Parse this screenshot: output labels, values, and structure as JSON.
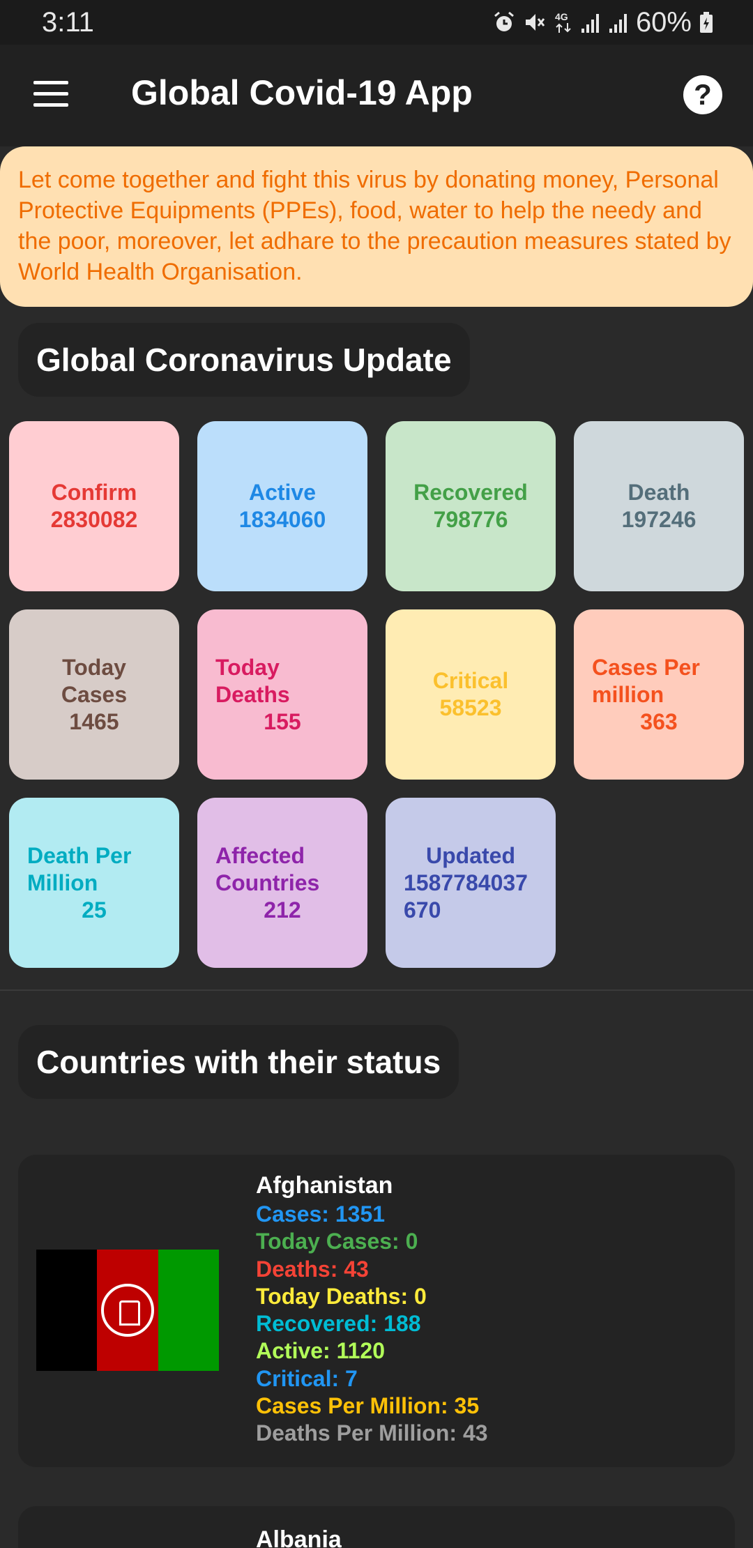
{
  "status_bar": {
    "time": "3:11",
    "battery": "60%",
    "icons": [
      "alarm-icon",
      "mute-icon",
      "4g-icon",
      "signal-icon",
      "signal-icon",
      "battery-icon"
    ]
  },
  "app_bar": {
    "title": "Global Covid-19 App",
    "menu_icon": "hamburger-menu-icon",
    "help_icon": "help-icon",
    "help_glyph": "?"
  },
  "banner": {
    "text": "Let come together and fight this virus by donating money, Personal Protective Equipments (PPEs), food, water to help the needy and the poor, moreover, let adhare to the precaution measures stated by World Health Organisation."
  },
  "global_section": {
    "title": "Global Coronavirus Update",
    "tiles": [
      {
        "label": "Confirm",
        "value": "2830082",
        "bg": "#ffcdd2",
        "fg": "#e53935"
      },
      {
        "label": "Active",
        "value": "1834060",
        "bg": "#bbdefb",
        "fg": "#1e88e5"
      },
      {
        "label": "Recovered",
        "value": "798776",
        "bg": "#c8e6c9",
        "fg": "#43a047"
      },
      {
        "label": "Death",
        "value": "197246",
        "bg": "#cfd8dc",
        "fg": "#546e7a"
      },
      {
        "label": "Today Cases",
        "value": "1465",
        "bg": "#d7ccc8",
        "fg": "#6d4c41"
      },
      {
        "label": "Today Deaths",
        "value": "155",
        "bg": "#f8bbd0",
        "fg": "#d81b60"
      },
      {
        "label": "Critical",
        "value": "58523",
        "bg": "#ffecb3",
        "fg": "#fbc02d"
      },
      {
        "label": "Cases Per million",
        "value": "363",
        "bg": "#ffccbc",
        "fg": "#f4511e"
      },
      {
        "label": "Death Per Million",
        "value": "25",
        "bg": "#b2ebf2",
        "fg": "#00acc1"
      },
      {
        "label": "Affected Countries",
        "value": "212",
        "bg": "#e1bee7",
        "fg": "#8e24aa"
      },
      {
        "label": "Updated",
        "value": "1587784037670",
        "bg": "#c5cae9",
        "fg": "#3949ab"
      }
    ]
  },
  "countries_section": {
    "title": "Countries with their status",
    "countries": [
      {
        "name": "Afghanistan",
        "flag_colors": [
          "#000000",
          "#be0000",
          "#009900"
        ],
        "stats": [
          {
            "text": "Cases: 1351",
            "color": "#2196f3"
          },
          {
            "text": "Today Cases: 0",
            "color": "#4caf50"
          },
          {
            "text": "Deaths: 43",
            "color": "#f44336"
          },
          {
            "text": "Today Deaths: 0",
            "color": "#ffeb3b"
          },
          {
            "text": "Recovered: 188",
            "color": "#00bcd4"
          },
          {
            "text": "Active: 1120",
            "color": "#b2ff59"
          },
          {
            "text": "Critical: 7",
            "color": "#2196f3"
          },
          {
            "text": "Cases Per Million: 35",
            "color": "#ffc107"
          },
          {
            "text": "Deaths Per Million: 43",
            "color": "#9e9e9e"
          }
        ]
      },
      {
        "name": "Albania"
      }
    ]
  }
}
